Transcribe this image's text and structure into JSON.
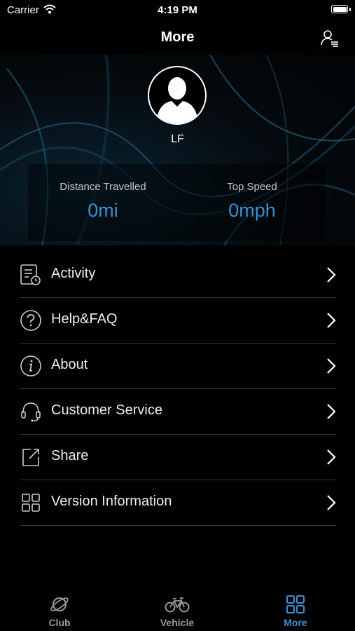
{
  "status_bar": {
    "carrier": "Carrier",
    "time": "4:19 PM"
  },
  "nav": {
    "title": "More",
    "profile_icon": "user-list-icon"
  },
  "profile": {
    "name": "LF"
  },
  "stats": [
    {
      "label": "Distance Travelled",
      "value": "0mi"
    },
    {
      "label": "Top Speed",
      "value": "0mph"
    }
  ],
  "menu": [
    {
      "label": "Activity",
      "icon": "activity-log-icon"
    },
    {
      "label": "Help&FAQ",
      "icon": "question-circle-icon"
    },
    {
      "label": "About",
      "icon": "info-circle-icon"
    },
    {
      "label": "Customer Service",
      "icon": "headset-icon"
    },
    {
      "label": "Share",
      "icon": "share-icon"
    },
    {
      "label": "Version Information",
      "icon": "grid-icon"
    }
  ],
  "tabs": [
    {
      "label": "Club",
      "icon": "planet-icon",
      "active": false
    },
    {
      "label": "Vehicle",
      "icon": "bicycle-icon",
      "active": false
    },
    {
      "label": "More",
      "icon": "grid-icon",
      "active": true
    }
  ],
  "colors": {
    "accent": "#3b8fd0",
    "background": "#000000",
    "divider": "#3a3a3a"
  }
}
